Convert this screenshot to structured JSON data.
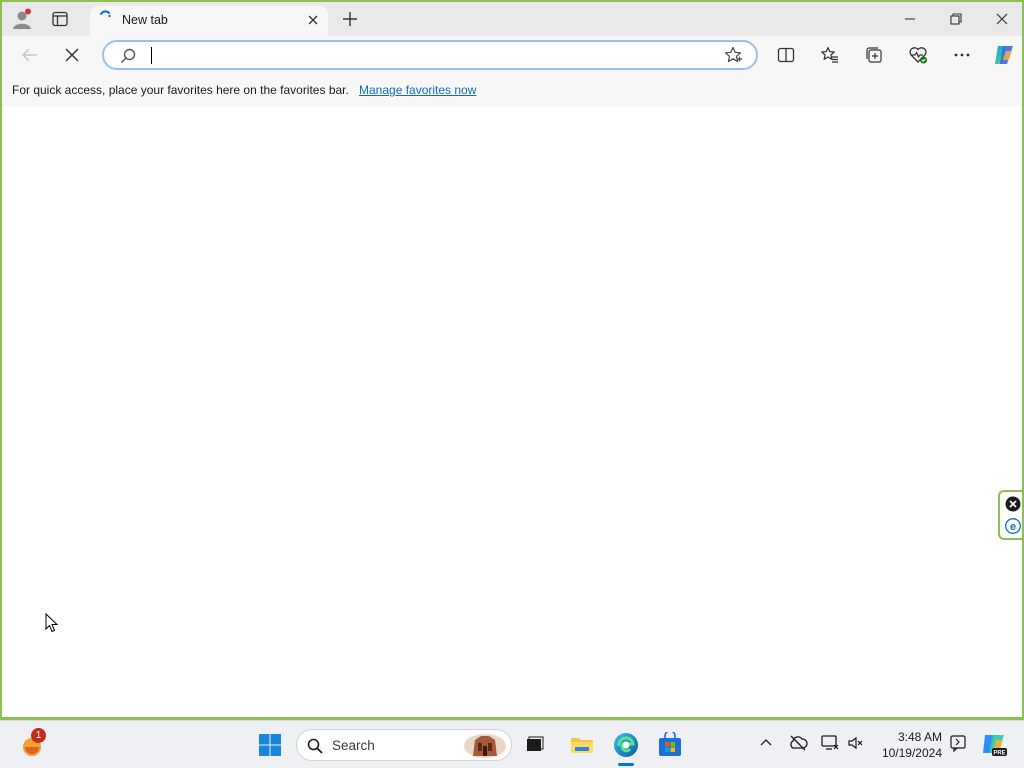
{
  "tab": {
    "title": "New tab"
  },
  "address": {
    "value": "",
    "placeholder": ""
  },
  "favorites_bar": {
    "message": "For quick access, place your favorites here on the favorites bar.",
    "link": "Manage favorites now"
  },
  "taskbar": {
    "search_label": "Search",
    "notification_count": "1",
    "time": "3:48 AM",
    "date": "10/19/2024"
  },
  "icons": {
    "profile": "profile-icon",
    "tab_actions": "tab-actions-icon",
    "new_tab": "plus-icon",
    "back": "back-arrow-icon",
    "stop": "stop-icon",
    "search": "search-icon",
    "favorite": "star-icon",
    "split_screen": "split-screen-icon",
    "favorites": "favorites-icon",
    "collections": "collections-icon",
    "browser_essentials": "heart-pulse-icon",
    "more": "more-icon",
    "copilot": "copilot-icon"
  },
  "colors": {
    "window_border": "#8cc152",
    "link": "#0f6cbd",
    "address_border": "#9bc1ea",
    "accent": "#0078d4"
  }
}
